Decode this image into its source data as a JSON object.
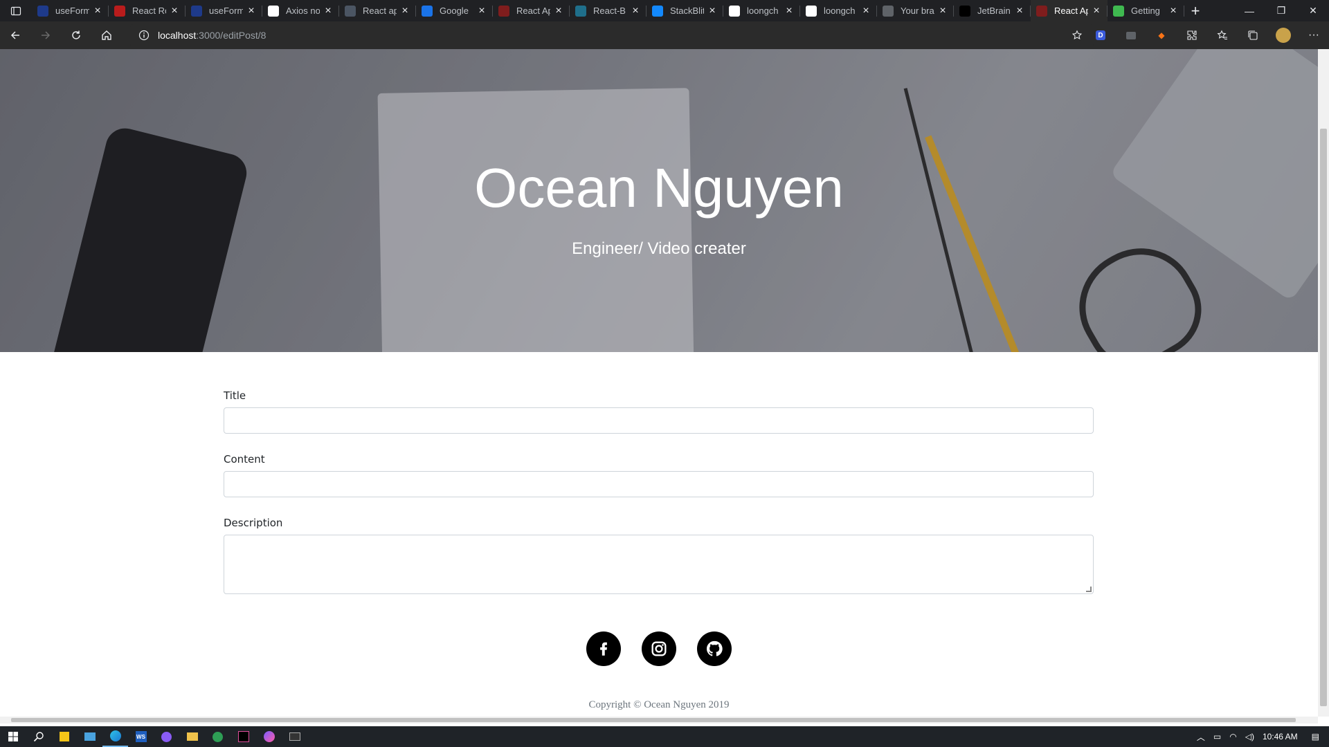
{
  "browser": {
    "tabs": [
      {
        "label": "useForm",
        "color": "#1e3a8a"
      },
      {
        "label": "React Ro",
        "color": "#b91c1c"
      },
      {
        "label": "useForm",
        "color": "#1e3a8a"
      },
      {
        "label": "Axios no",
        "color": "#ffffff"
      },
      {
        "label": "React ap",
        "color": "#4b5563"
      },
      {
        "label": "Google",
        "color": "#1a73e8"
      },
      {
        "label": "React Ap",
        "color": "#7f1d1d"
      },
      {
        "label": "React-B",
        "color": "#1f6f8b"
      },
      {
        "label": "StackBlit",
        "color": "#1389fd"
      },
      {
        "label": "loongch",
        "color": "#ffffff"
      },
      {
        "label": "loongch",
        "color": "#ffffff"
      },
      {
        "label": "Your bra",
        "color": "#5f6368"
      },
      {
        "label": "JetBrain",
        "color": "#000000"
      },
      {
        "label": "React Ap",
        "color": "#7f1d1d"
      },
      {
        "label": "Getting",
        "color": "#3fb950"
      }
    ],
    "active_tab_index": 13,
    "url_host": "localhost",
    "url_path": ":3000/editPost/8"
  },
  "hero": {
    "title": "Ocean Nguyen",
    "subtitle": "Engineer/ Video creater"
  },
  "form": {
    "title_label": "Title",
    "content_label": "Content",
    "description_label": "Description",
    "title_value": "",
    "content_value": "",
    "description_value": ""
  },
  "social": [
    "facebook-icon",
    "instagram-icon",
    "github-icon"
  ],
  "footer": {
    "copyright": "Copyright © Ocean Nguyen 2019"
  },
  "taskbar": {
    "time": "10:46 AM"
  }
}
